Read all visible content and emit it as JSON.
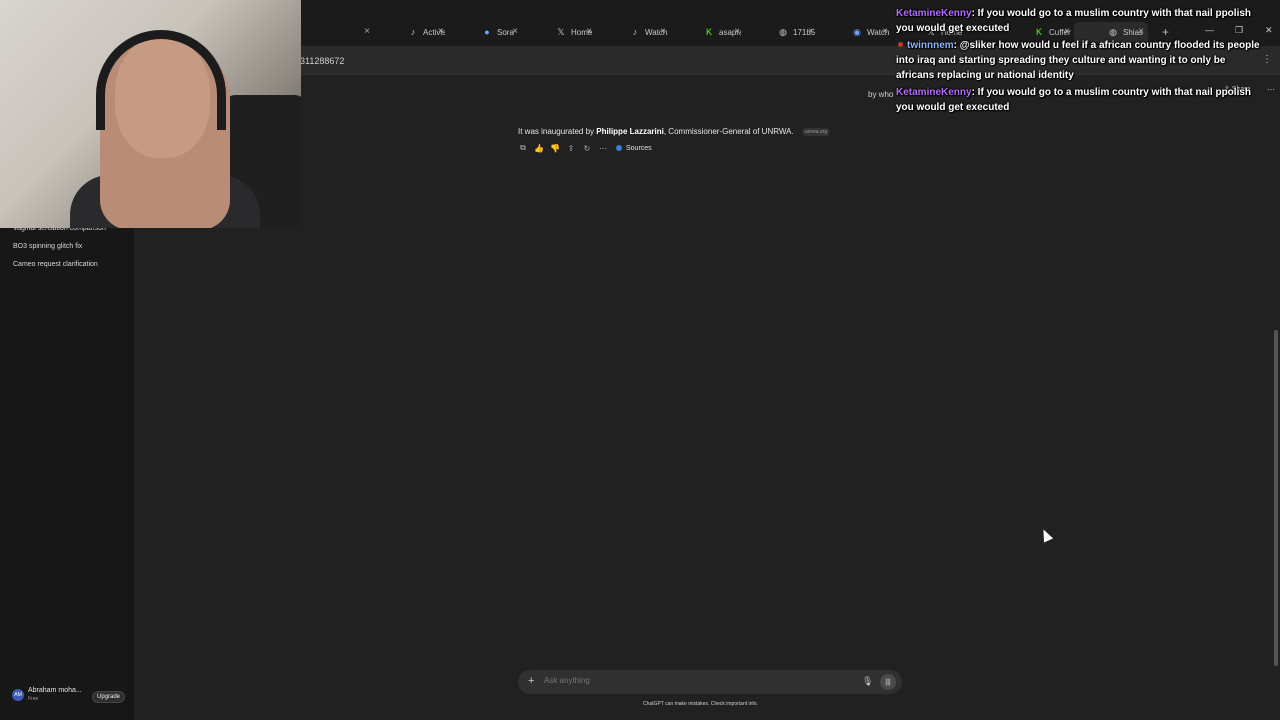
{
  "browser": {
    "tabs": [
      {
        "icon": "",
        "label": ""
      },
      {
        "icon": "tiktok-icon",
        "label": "Activist"
      },
      {
        "icon": "sora-icon",
        "label": "Sora"
      },
      {
        "icon": "x-icon",
        "label": "Home /"
      },
      {
        "icon": "tiktok-icon",
        "label": "Watch !"
      },
      {
        "icon": "kick-icon",
        "label": "asapran"
      },
      {
        "icon": "globe-icon",
        "label": "171b58"
      },
      {
        "icon": "chatgpt-icon",
        "label": "Watch"
      },
      {
        "icon": "x-icon",
        "label": "Home"
      },
      {
        "icon": "",
        "label": ""
      },
      {
        "icon": "kick-icon",
        "label": "Cuffem"
      },
      {
        "icon": "chatgpt-icon",
        "label": "Shias k"
      }
    ],
    "address_text": "311288672"
  },
  "sidebar": {
    "items": [
      {
        "label": "Vaginal sensation comparison"
      },
      {
        "label": "BO3 spinning glitch fix"
      },
      {
        "label": "Cameo request clarification"
      }
    ],
    "user": {
      "initials": "AM",
      "name": "Abraham moha...",
      "plan": "Free",
      "upgrade_label": "Upgrade"
    }
  },
  "header": {
    "by_who": "by who",
    "share_label": "Share"
  },
  "conversation": {
    "message_prefix": "It was inaugurated by ",
    "message_bold": "Philippe Lazzarini",
    "message_suffix": ", Commissioner-General of UNRWA.",
    "source_chip": "unrwa.org",
    "sources_label": "Sources"
  },
  "composer": {
    "placeholder": "Ask anything",
    "disclaimer": "ChatGPT can make mistakes. Check important info."
  },
  "chat_overlay": [
    {
      "user": "KetamineKenny",
      "text": ": If you would go to a muslim country with that nail ppolish you would get executed",
      "color": "#b469ff"
    },
    {
      "user": "twinnnem",
      "text": ": @sliker how would u feel if a african country flooded its people into iraq and starting spreading they culture and wanting it to only be africans replacing ur national identity",
      "color": "#8ab4f8"
    },
    {
      "user": "KetamineKenny",
      "text": ": If you would go to a muslim country with that nail ppolish you would get executed",
      "color": "#b469ff"
    }
  ],
  "colors": {
    "background": "#212121",
    "sidebar": "#171717",
    "composer": "#303030",
    "chat_user_primary": "#b469ff"
  }
}
